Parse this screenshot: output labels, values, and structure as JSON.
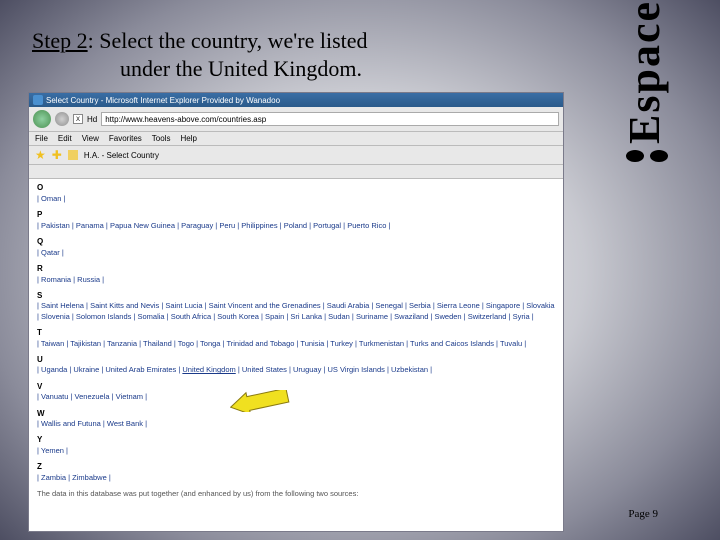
{
  "title": {
    "step": "Step 2",
    "text_after": ": Select the country, we're listed",
    "line2": "under the United Kingdom."
  },
  "espace": "Espace",
  "browser": {
    "title": "Select Country - Microsoft Internet Explorer Provided by Wanadoo",
    "url": "http://www.heavens-above.com/countries.asp",
    "xlabel": "X",
    "menu": {
      "file": "File",
      "edit": "Edit",
      "view": "View",
      "favorites": "Favorites",
      "tools": "Tools",
      "help": "Help"
    },
    "fav_label": "H.A. - Select Country",
    "groups": [
      {
        "letter": "O",
        "countries": "| Oman |"
      },
      {
        "letter": "P",
        "countries": "| Pakistan | Panama | Papua New Guinea | Paraguay | Peru | Philippines | Poland | Portugal | Puerto Rico |"
      },
      {
        "letter": "Q",
        "countries": "| Qatar |"
      },
      {
        "letter": "R",
        "countries": "| Romania | Russia |"
      },
      {
        "letter": "S",
        "countries": "| Saint Helena | Saint Kitts and Nevis | Saint Lucia | Saint Vincent and the Grenadines | Saudi Arabia | Senegal | Serbia | Sierra Leone | Singapore | Slovakia | Slovenia | Solomon Islands | Somalia | South Africa | South Korea | Spain | Sri Lanka | Sudan | Suriname | Swaziland | Sweden | Switzerland | Syria |"
      },
      {
        "letter": "T",
        "countries": "| Taiwan | Tajikistan | Tanzania | Thailand | Togo | Tonga | Trinidad and Tobago | Tunisia | Turkey | Turkmenistan | Turks and Caicos Islands | Tuvalu |"
      },
      {
        "letter": "U",
        "countries_before_uk": "| Uganda | Ukraine | United Arab Emirates | ",
        "uk": "United Kingdom",
        "countries_after_uk": " | United States | Uruguay | US Virgin Islands | Uzbekistan |"
      },
      {
        "letter": "V",
        "countries": "| Vanuatu | Venezuela | Vietnam |"
      },
      {
        "letter": "W",
        "countries": "| Wallis and Futuna | West Bank |"
      },
      {
        "letter": "Y",
        "countries": "| Yemen |"
      },
      {
        "letter": "Z",
        "countries": "| Zambia | Zimbabwe |"
      }
    ],
    "footer": "The data in this database was put together (and enhanced by us) from the following two sources:"
  },
  "page": "Page 9"
}
